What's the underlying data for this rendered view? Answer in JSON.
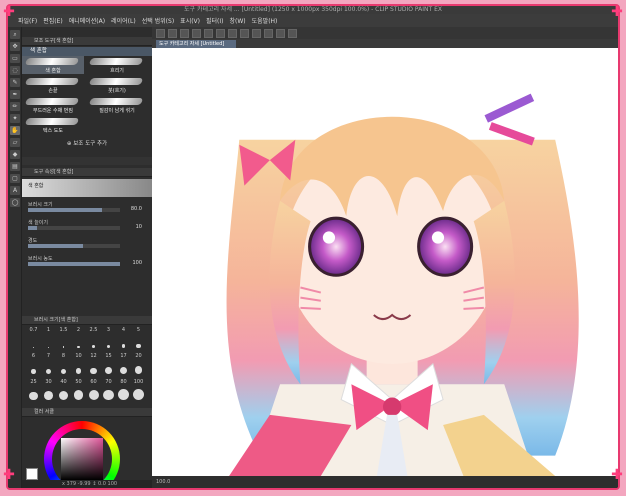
{
  "window": {
    "title": "도구 카테고리 자세 ... [Untitled] (1250 x 1000px 350dpi 100.0%) - CLIP STUDIO PAINT EX"
  },
  "menu": [
    "파일(F)",
    "편집(E)",
    "애니메이션(A)",
    "레이어(L)",
    "선택 범위(S)",
    "표시(V)",
    "필터(I)",
    "창(W)",
    "도움말(H)"
  ],
  "subtool_panel": {
    "header": "보조 도구[색 혼합]",
    "active_tab": "색 혼합",
    "brushes": [
      {
        "label": "색 혼합",
        "selected": true
      },
      {
        "label": "흐리기",
        "selected": false
      },
      {
        "label": "손끝",
        "selected": false
      },
      {
        "label": "붓(흐기)",
        "selected": false
      },
      {
        "label": "부드러운 수채 번짐",
        "selected": false
      },
      {
        "label": "질감이 남게 섞기",
        "selected": false
      },
      {
        "label": "텍스 도도",
        "selected": false
      }
    ],
    "add_label": "보조 도구 추가"
  },
  "tool_property": {
    "header": "도구 속성[색 혼합]",
    "preview_label": "색 혼합",
    "props": [
      {
        "label": "브러시 크기",
        "value": "80.0",
        "fill": 0.8
      },
      {
        "label": "색 늘이기",
        "value": "10",
        "fill": 0.1
      },
      {
        "label": "경도",
        "value": "",
        "fill": 0.6
      },
      {
        "label": "브러시 농도",
        "value": "100",
        "fill": 1.0
      }
    ]
  },
  "brush_size": {
    "header": "브러시 크기[색 혼합]",
    "sizes": [
      "0.7",
      "1",
      "1.5",
      "2",
      "2.5",
      "3",
      "4",
      "5",
      "6",
      "7",
      "8",
      "10",
      "12",
      "15",
      "17",
      "20",
      "25",
      "30",
      "40",
      "50",
      "60",
      "70",
      "80",
      "100"
    ]
  },
  "color_panel": {
    "header": "컬러 서클"
  },
  "status": {
    "zoom": "100.0",
    "left_status": "x 379 -9.99 ↕ 0.0 100"
  },
  "document_tab": "도구 카테고리 자세 [Untitled]",
  "colors": {
    "frame": "#e8396f",
    "frame_bg": "#f3a6bf",
    "panel": "#2d2d2d",
    "selected_tab": "#4a5766"
  }
}
